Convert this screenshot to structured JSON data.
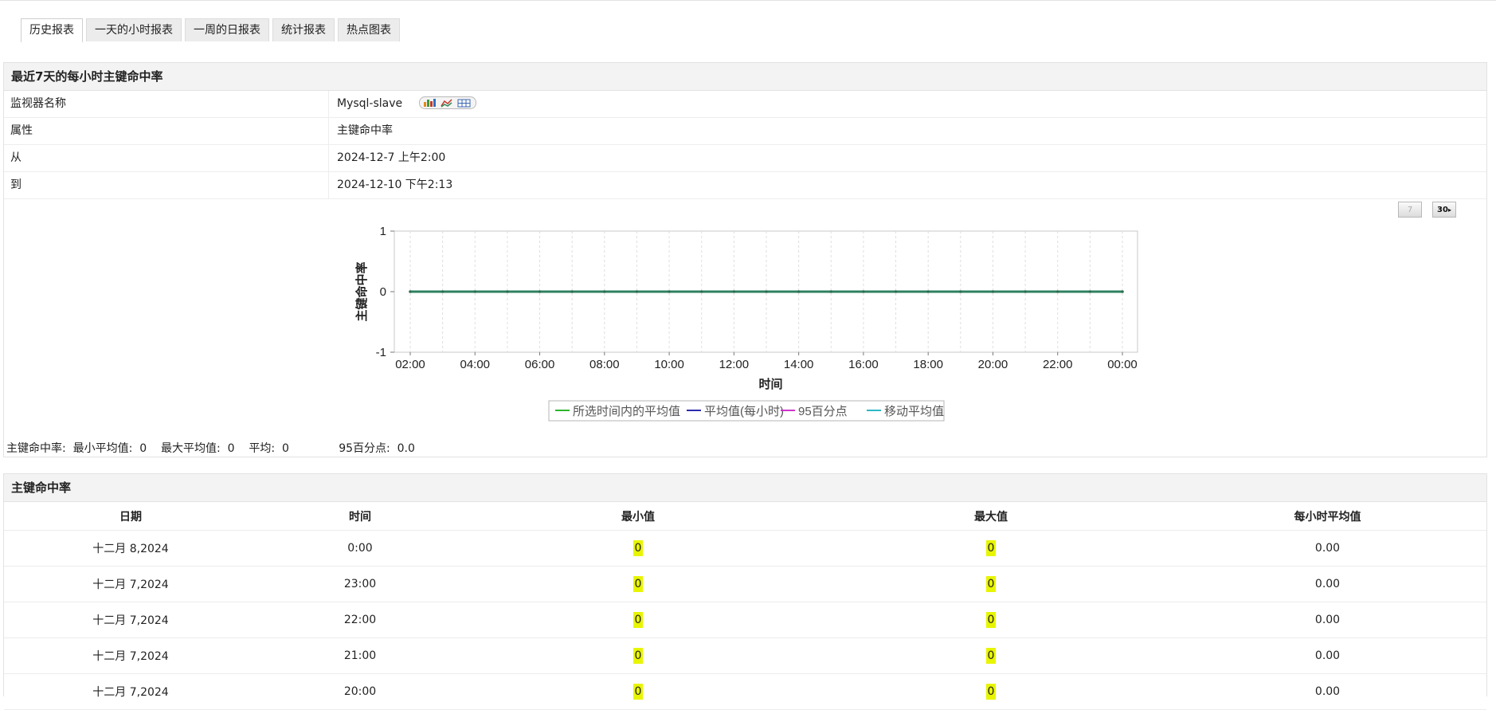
{
  "tabs": [
    {
      "label": "历史报表",
      "active": true
    },
    {
      "label": "一天的小时报表",
      "active": false
    },
    {
      "label": "一周的日报表",
      "active": false
    },
    {
      "label": "统计报表",
      "active": false
    },
    {
      "label": "热点图表",
      "active": false
    }
  ],
  "panel1": {
    "title": "最近7天的每小时主键命中率",
    "rows": [
      {
        "label": "监视器名称",
        "value": "Mysql-slave"
      },
      {
        "label": "属性",
        "value": "主键命中率"
      },
      {
        "label": "从",
        "value": "2024-12-7 上午2:00"
      },
      {
        "label": "到",
        "value": "2024-12-10 下午2:13"
      }
    ],
    "buttons": {
      "seven": "7",
      "thirty": "30"
    }
  },
  "chart_data": {
    "type": "line",
    "xlabel": "时间",
    "ylabel": "主键命中率",
    "ylim": [
      -1,
      1
    ],
    "yticks": [
      -1,
      0,
      1
    ],
    "xticks": [
      "02:00",
      "04:00",
      "06:00",
      "08:00",
      "10:00",
      "12:00",
      "14:00",
      "16:00",
      "18:00",
      "20:00",
      "22:00",
      "00:00"
    ],
    "x": [
      "02:00",
      "03:00",
      "04:00",
      "05:00",
      "06:00",
      "07:00",
      "08:00",
      "09:00",
      "10:00",
      "11:00",
      "12:00",
      "13:00",
      "14:00",
      "15:00",
      "16:00",
      "17:00",
      "18:00",
      "19:00",
      "20:00",
      "21:00",
      "22:00",
      "23:00",
      "00:00"
    ],
    "series": [
      {
        "name": "所选时间内的平均值",
        "color": "#2db52d",
        "values": [
          0,
          0,
          0,
          0,
          0,
          0,
          0,
          0,
          0,
          0,
          0,
          0,
          0,
          0,
          0,
          0,
          0,
          0,
          0,
          0,
          0,
          0,
          0
        ]
      },
      {
        "name": "平均值(每小时)",
        "color": "#2b2bb0",
        "values": [
          0,
          0,
          0,
          0,
          0,
          0,
          0,
          0,
          0,
          0,
          0,
          0,
          0,
          0,
          0,
          0,
          0,
          0,
          0,
          0,
          0,
          0,
          0
        ]
      },
      {
        "name": "95百分点",
        "color": "#cc33cc",
        "values": [
          0,
          0,
          0,
          0,
          0,
          0,
          0,
          0,
          0,
          0,
          0,
          0,
          0,
          0,
          0,
          0,
          0,
          0,
          0,
          0,
          0,
          0,
          0
        ]
      },
      {
        "name": "移动平均值",
        "color": "#2bb8c8",
        "values": [
          0,
          0,
          0,
          0,
          0,
          0,
          0,
          0,
          0,
          0,
          0,
          0,
          0,
          0,
          0,
          0,
          0,
          0,
          0,
          0,
          0,
          0,
          0
        ]
      }
    ],
    "grid": true,
    "legend": "bottom"
  },
  "summary": {
    "label": "主键命中率:",
    "min_avg_label": "最小平均值:",
    "min_avg": "0",
    "max_avg_label": "最大平均值:",
    "max_avg": "0",
    "avg_label": "平均:",
    "avg": "0",
    "p95_label": "95百分点:",
    "p95": "0.0"
  },
  "panel2": {
    "title": "主键命中率",
    "columns": [
      "日期",
      "时间",
      "最小值",
      "最大值",
      "每小时平均值"
    ],
    "rows": [
      [
        "十二月 8,2024",
        "0:00",
        "0",
        "0",
        "0.00"
      ],
      [
        "十二月 7,2024",
        "23:00",
        "0",
        "0",
        "0.00"
      ],
      [
        "十二月 7,2024",
        "22:00",
        "0",
        "0",
        "0.00"
      ],
      [
        "十二月 7,2024",
        "21:00",
        "0",
        "0",
        "0.00"
      ],
      [
        "十二月 7,2024",
        "20:00",
        "0",
        "0",
        "0.00"
      ]
    ]
  }
}
